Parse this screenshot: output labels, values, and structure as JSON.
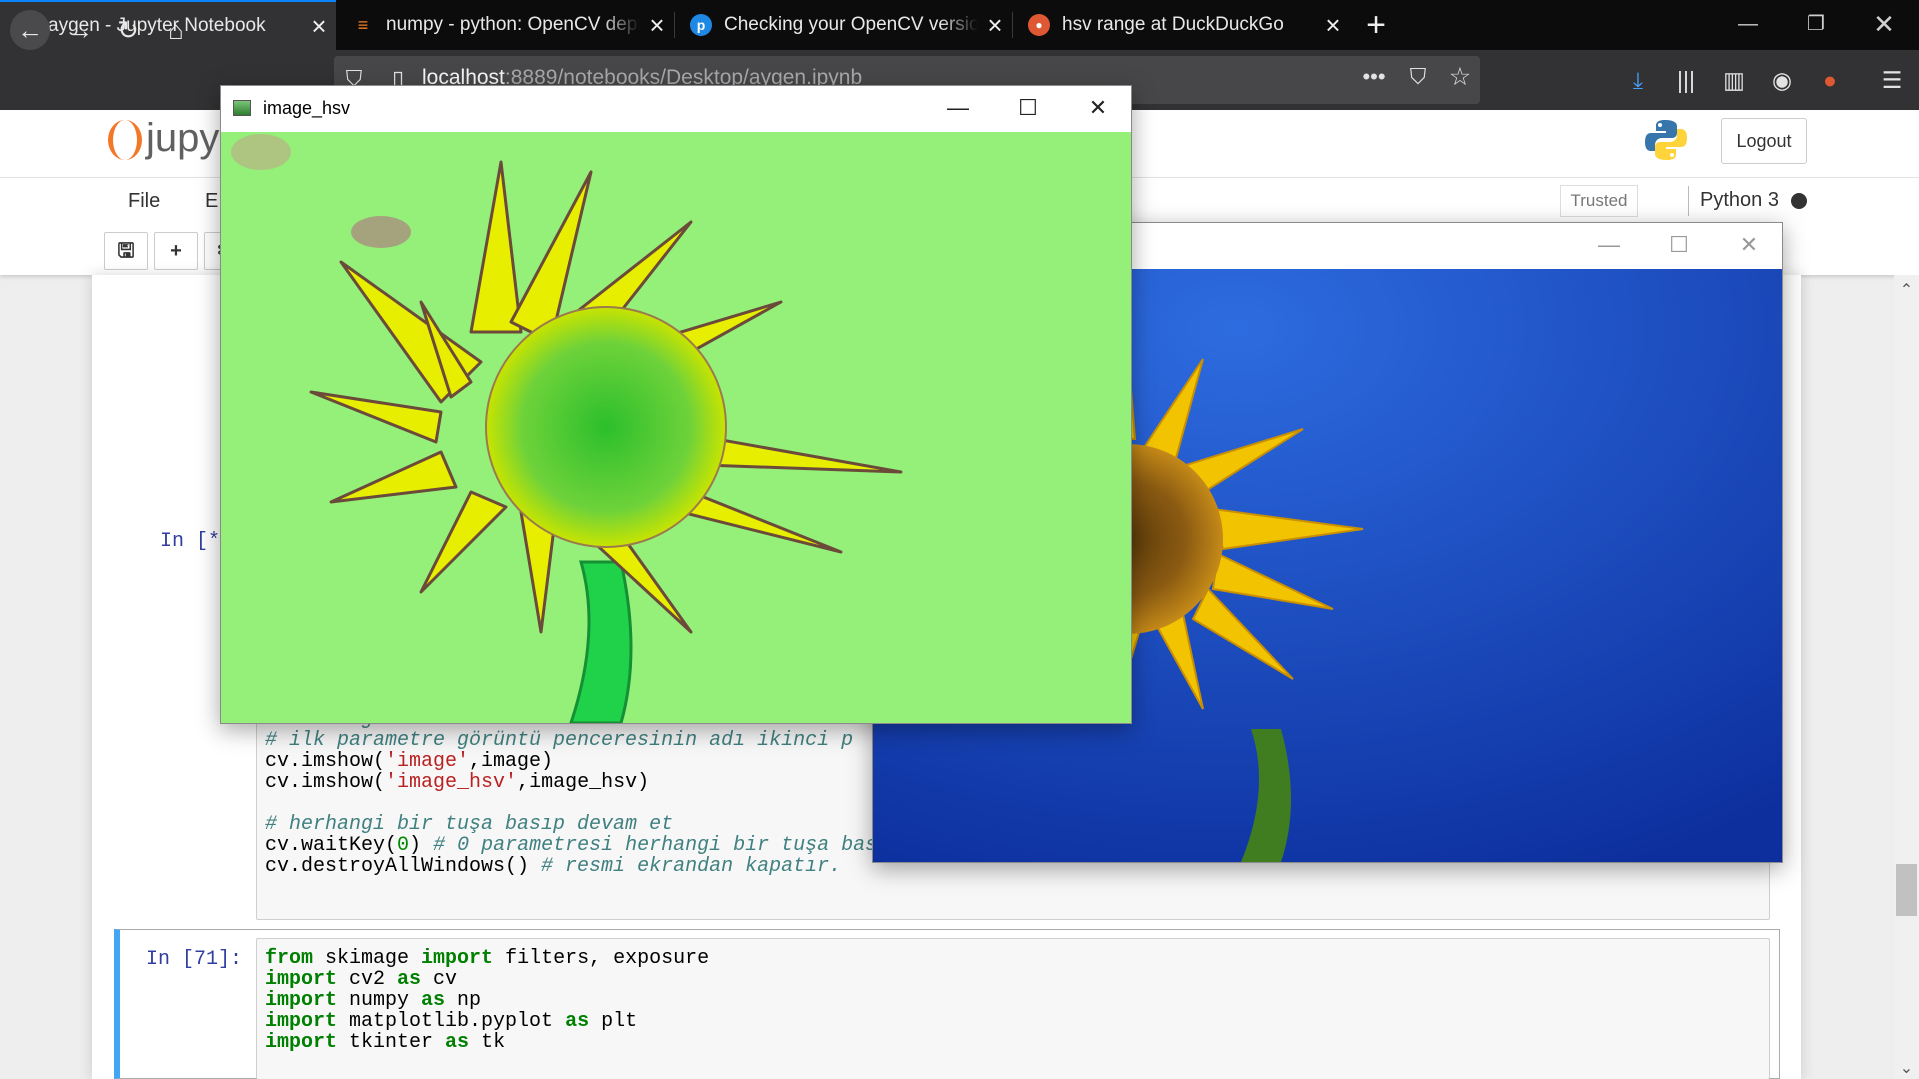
{
  "browser": {
    "tabs": [
      {
        "label": "aygen - Jupyter Notebook",
        "icon": "hourglass-icon",
        "active": true
      },
      {
        "label": "numpy - python: OpenCV dept",
        "icon": "stackoverflow-icon",
        "active": false
      },
      {
        "label": "Checking your OpenCV version",
        "icon": "pyimagesearch-icon",
        "active": false
      },
      {
        "label": "hsv range at DuckDuckGo",
        "icon": "duckduckgo-icon",
        "active": false
      }
    ],
    "url_host": "localhost",
    "url_path": ":8889/notebooks/Desktop/aygen.ipynb",
    "colors": {
      "tabbar": "#0c0c0d",
      "navbar": "#323234",
      "accent": "#0a84ff"
    }
  },
  "jupyter": {
    "logo_text": "jupy",
    "logout_label": "Logout",
    "menu": [
      "File",
      "E"
    ],
    "trusted_label": "Trusted",
    "kernel_name": "Python 3",
    "toolbar_icons": [
      "save-icon",
      "plus-icon",
      "cut-icon"
    ]
  },
  "cells": {
    "running_prompt": "In [*",
    "lines_cell1": [
      {
        "t": "c",
        "text": "# resmi görüntüleme"
      },
      {
        "t": "c",
        "text": "# ilk parametre görüntü penceresinin adı ikinci p"
      },
      {
        "t": "x",
        "parts": [
          [
            "",
            "cv.imshow("
          ],
          [
            "s",
            "'image'"
          ],
          [
            "",
            ",image)"
          ]
        ]
      },
      {
        "t": "x",
        "parts": [
          [
            "",
            "cv.imshow("
          ],
          [
            "s",
            "'image_hsv'"
          ],
          [
            "",
            ",image_hsv)"
          ]
        ]
      },
      {
        "t": "e",
        "text": ""
      },
      {
        "t": "c",
        "text": "# herhangi bir tuşa basıp devam et"
      },
      {
        "t": "x",
        "parts": [
          [
            "",
            "cv.waitKey("
          ],
          [
            "n",
            "0"
          ],
          [
            "",
            ") "
          ],
          [
            "c",
            "# 0 parametresi herhangi bir tuşa basıldığında devam etmesini sağlar."
          ]
        ]
      },
      {
        "t": "x",
        "parts": [
          [
            "",
            "cv.destroyAllWindows() "
          ],
          [
            "c",
            "# resmi ekrandan kapatır."
          ]
        ]
      }
    ],
    "prompt_cell2": "In [71]:",
    "lines_cell2": [
      [
        [
          "k",
          "from"
        ],
        [
          "",
          " skimage "
        ],
        [
          "k",
          "import"
        ],
        [
          "",
          " filters, exposure"
        ]
      ],
      [
        [
          "k",
          "import"
        ],
        [
          "",
          " cv2 "
        ],
        [
          "k",
          "as"
        ],
        [
          "",
          " cv"
        ]
      ],
      [
        [
          "k",
          "import"
        ],
        [
          "",
          " numpy "
        ],
        [
          "k",
          "as"
        ],
        [
          "",
          " np"
        ]
      ],
      [
        [
          "k",
          "import"
        ],
        [
          "",
          " matplotlib.pyplot "
        ],
        [
          "k",
          "as"
        ],
        [
          "",
          " plt"
        ]
      ],
      [
        [
          "k",
          "import"
        ],
        [
          "",
          " tkinter "
        ],
        [
          "k",
          "as"
        ],
        [
          "",
          " tk"
        ]
      ]
    ]
  },
  "windows": {
    "hsv": {
      "title": "image_hsv"
    },
    "image": {
      "title": ""
    }
  }
}
